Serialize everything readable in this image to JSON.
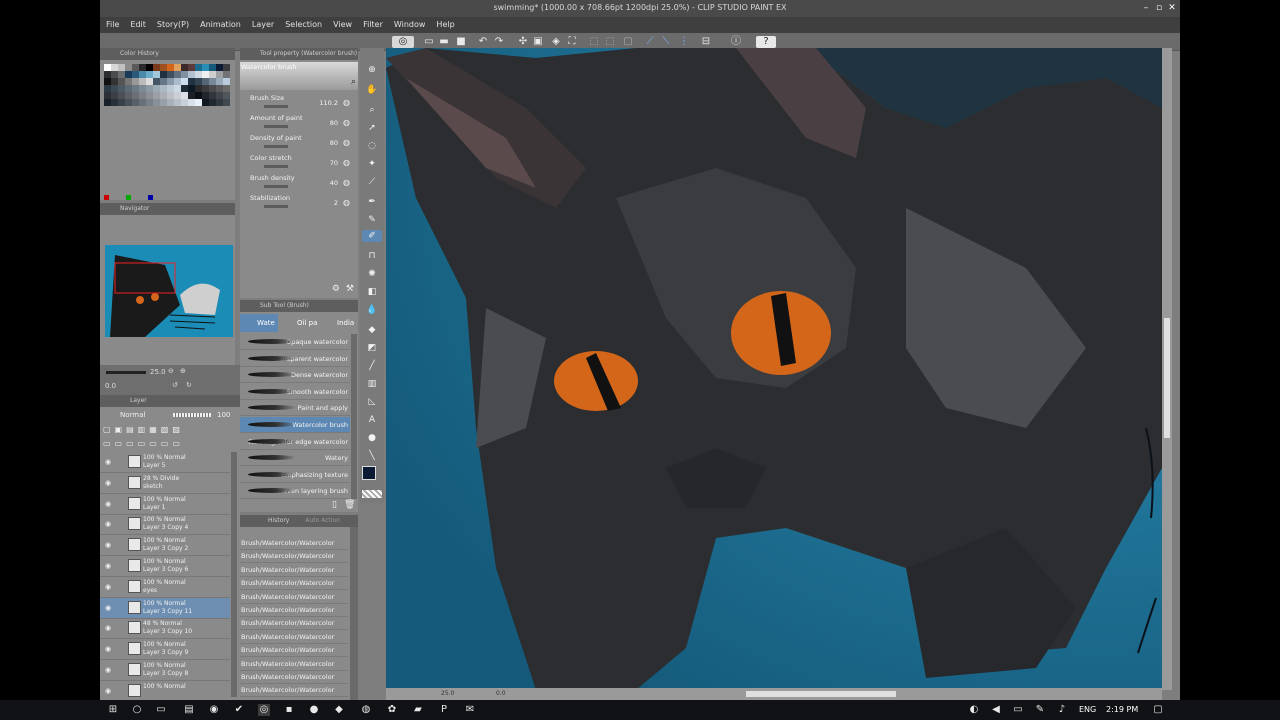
{
  "window": {
    "title": "swimming* (1000.00 x 708.66pt 1200dpi 25.0%) - CLIP STUDIO PAINT EX"
  },
  "menu": [
    "File",
    "Edit",
    "Story(P)",
    "Animation",
    "Layer",
    "Selection",
    "View",
    "Filter",
    "Window",
    "Help"
  ],
  "panels": {
    "color_history_title": "Color History",
    "tool_property_title": "Tool property (Watercolor brush)",
    "navigator_title": "Navigator",
    "subtool_title": "Sub Tool (Brush)",
    "history_title": "History",
    "auto_action_title": "Auto Action",
    "layer_title": "Layer"
  },
  "tool_property": {
    "brush_name": "Watercolor brush",
    "rows": [
      {
        "label": "Brush Size",
        "value": "110.2"
      },
      {
        "label": "Amount of paint",
        "value": "80"
      },
      {
        "label": "Density of paint",
        "value": "80"
      },
      {
        "label": "Color stretch",
        "value": "70"
      },
      {
        "label": "Brush density",
        "value": "40"
      },
      {
        "label": "Stabilization",
        "value": "2"
      }
    ]
  },
  "subtool": {
    "tabs": [
      "Wate",
      "Oil pa",
      "India"
    ],
    "brushes": [
      "Opaque watercolor",
      "Transparent watercolor",
      "Dense watercolor",
      "Smooth watercolor",
      "Paint and apply",
      "Watercolor brush",
      "Running color edge watercolor",
      "Watery",
      "Emphasizing texture",
      "Uneven layering brush"
    ],
    "selected": "Watercolor brush"
  },
  "history": {
    "items": [
      "Brush/Watercolor/Watercolor",
      "Brush/Watercolor/Watercolor",
      "Brush/Watercolor/Watercolor",
      "Brush/Watercolor/Watercolor",
      "Brush/Watercolor/Watercolor",
      "Brush/Watercolor/Watercolor",
      "Brush/Watercolor/Watercolor",
      "Brush/Watercolor/Watercolor",
      "Brush/Watercolor/Watercolor",
      "Brush/Watercolor/Watercolor",
      "Brush/Watercolor/Watercolor",
      "Brush/Watercolor/Watercolor"
    ]
  },
  "navigator": {
    "zoom": "25.0",
    "rotation": "0.0"
  },
  "layer_panel": {
    "blend_mode": "Normal",
    "opacity": "100",
    "layers": [
      {
        "top": "100 % Normal",
        "name": "Layer 5"
      },
      {
        "top": "28 % Divide",
        "name": "sketch"
      },
      {
        "top": "100 % Normal",
        "name": "Layer 1"
      },
      {
        "top": "100 % Normal",
        "name": "Layer 3 Copy 4"
      },
      {
        "top": "100 % Normal",
        "name": "Layer 3 Copy 2"
      },
      {
        "top": "100 % Normal",
        "name": "Layer 3 Copy 6"
      },
      {
        "top": "100 % Normal",
        "name": "eyes"
      },
      {
        "top": "100 % Normal",
        "name": "Layer 3 Copy 11"
      },
      {
        "top": "48 % Normal",
        "name": "Layer 3 Copy 10"
      },
      {
        "top": "100 % Normal",
        "name": "Layer 3 Copy 9"
      },
      {
        "top": "100 % Normal",
        "name": "Layer 3 Copy 8"
      },
      {
        "top": "100 % Normal",
        "name": ""
      }
    ],
    "selected_index": 7
  },
  "canvas_status": {
    "zoom": "25.0",
    "angle": "0.0"
  },
  "taskbar": {
    "lang": "ENG",
    "time": "2:19 PM"
  },
  "colors": {
    "canvas_bg": "#1a6a8c",
    "eye": "#d4661a",
    "selection": "#5e88b4"
  }
}
